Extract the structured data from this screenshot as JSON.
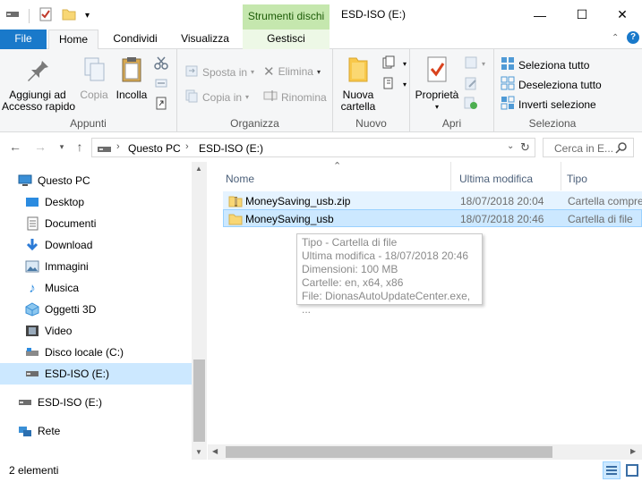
{
  "titlebar": {
    "context_tab_title": "Strumenti dischi",
    "window_title": "ESD-ISO (E:)",
    "minimize": "—",
    "maximize": "☐",
    "close": "✕"
  },
  "tabs": {
    "file": "File",
    "home": "Home",
    "share": "Condividi",
    "view": "Visualizza",
    "manage": "Gestisci"
  },
  "ribbon": {
    "clipboard": {
      "pin_label": "Aggiungi ad\nAccesso rapido",
      "copy_label": "Copia",
      "paste_label": "Incolla",
      "group_label": "Appunti"
    },
    "organize": {
      "move_to": "Sposta in",
      "copy_to": "Copia in",
      "delete": "Elimina",
      "rename": "Rinomina",
      "group_label": "Organizza"
    },
    "new": {
      "new_folder": "Nuova\ncartella",
      "group_label": "Nuovo"
    },
    "open": {
      "properties": "Proprietà",
      "group_label": "Apri"
    },
    "select": {
      "select_all": "Seleziona tutto",
      "select_none": "Deseleziona tutto",
      "invert": "Inverti selezione",
      "group_label": "Seleziona"
    }
  },
  "address": {
    "crumbs": [
      "Questo PC",
      "ESD-ISO (E:)"
    ],
    "search_placeholder": "Cerca in E..."
  },
  "navpane": {
    "items": [
      {
        "label": "Questo PC",
        "icon": "computer-icon"
      },
      {
        "label": "Desktop",
        "icon": "desktop-icon"
      },
      {
        "label": "Documenti",
        "icon": "documents-icon"
      },
      {
        "label": "Download",
        "icon": "download-icon"
      },
      {
        "label": "Immagini",
        "icon": "pictures-icon"
      },
      {
        "label": "Musica",
        "icon": "music-icon"
      },
      {
        "label": "Oggetti 3D",
        "icon": "objects3d-icon"
      },
      {
        "label": "Video",
        "icon": "video-icon"
      },
      {
        "label": "Disco locale (C:)",
        "icon": "drive-icon"
      },
      {
        "label": "ESD-ISO (E:)",
        "icon": "drive-icon"
      },
      {
        "label": "ESD-ISO (E:)",
        "icon": "drive-icon"
      },
      {
        "label": "Rete",
        "icon": "network-icon"
      }
    ]
  },
  "filelist": {
    "columns": {
      "name": "Nome",
      "modified": "Ultima modifica",
      "type": "Tipo"
    },
    "rows": [
      {
        "name": "MoneySaving_usb.zip",
        "modified": "18/07/2018 20:04",
        "type": "Cartella compressa"
      },
      {
        "name": "MoneySaving_usb",
        "modified": "18/07/2018 20:46",
        "type": "Cartella di file"
      }
    ]
  },
  "tooltip": {
    "line1": "Tipo - Cartella di file",
    "line2": "Ultima modifica - 18/07/2018 20:46",
    "line3": "Dimensioni: 100 MB",
    "line4": "Cartelle: en, x64, x86",
    "line5": "File: DionasAutoUpdateCenter.exe, ..."
  },
  "status": {
    "count": "2 elementi"
  },
  "colors": {
    "accent": "#1979ca",
    "context_tab": "#c5e7ae",
    "selection": "#cce8ff"
  }
}
